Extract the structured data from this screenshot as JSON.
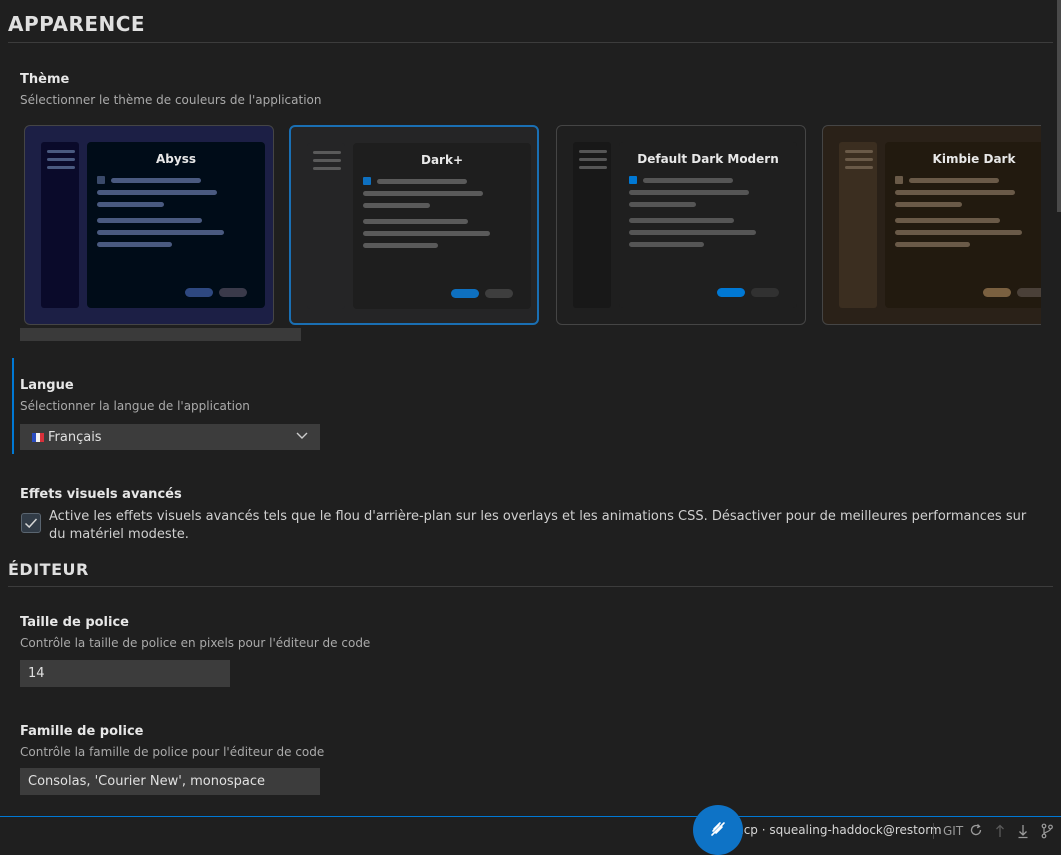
{
  "sections": {
    "appearance_title": "APPARENCE",
    "editor_title": "ÉDITEUR"
  },
  "theme": {
    "title": "Thème",
    "description": "Sélectionner le thème de couleurs de l'application",
    "selected": "Dark+",
    "cards": [
      {
        "name": "Abyss",
        "bg": "#1c1f45",
        "sidebar": "#0a0a2a",
        "main": "#000c18",
        "line": "#4a5a80",
        "dot": "#3a4a6a",
        "btn1": "#2e4880",
        "btn2": "#3a3a4a"
      },
      {
        "name": "Dark+",
        "bg": "#252526",
        "sidebar": "#252526",
        "main": "#1e1e1e",
        "line": "#5a5a5a",
        "dot": "#0e70c0",
        "btn1": "#0e70c0",
        "btn2": "#3e3e3e"
      },
      {
        "name": "Default Dark Modern",
        "bg": "#1f1f1f",
        "sidebar": "#181818",
        "main": "#1f1f1f",
        "line": "#555555",
        "dot": "#0078d4",
        "btn1": "#0078d4",
        "btn2": "#313131"
      },
      {
        "name": "Kimbie Dark",
        "bg": "#2a2118",
        "sidebar": "#3b2e20",
        "main": "#221a0f",
        "line": "#6a5a48",
        "dot": "#6a5a48",
        "btn1": "#7a6040",
        "btn2": "#4a4038"
      }
    ]
  },
  "language": {
    "title": "Langue",
    "description": "Sélectionner la langue de l'application",
    "selected": "Français"
  },
  "effects": {
    "title": "Effets visuels avancés",
    "checked": true,
    "label": "Active les effets visuels avancés tels que le flou d'arrière-plan sur les overlays et les animations CSS. Désactiver pour de meilleures performances sur du matériel modeste."
  },
  "font_size": {
    "title": "Taille de police",
    "description": "Contrôle la taille de police en pixels pour l'éditeur de code",
    "value": "14"
  },
  "font_family": {
    "title": "Famille de police",
    "description": "Contrôle la famille de police pour l'éditeur de code",
    "value": "Consolas, 'Courier New', monospace"
  },
  "status_bar": {
    "user": "mcp · squealing-haddock@restorm",
    "git_label": "GIT",
    "icons": [
      "refresh-icon",
      "push-icon",
      "pull-icon",
      "branch-icon"
    ]
  },
  "colors": {
    "accent": "#0078d4",
    "background": "#1f1f1f"
  }
}
